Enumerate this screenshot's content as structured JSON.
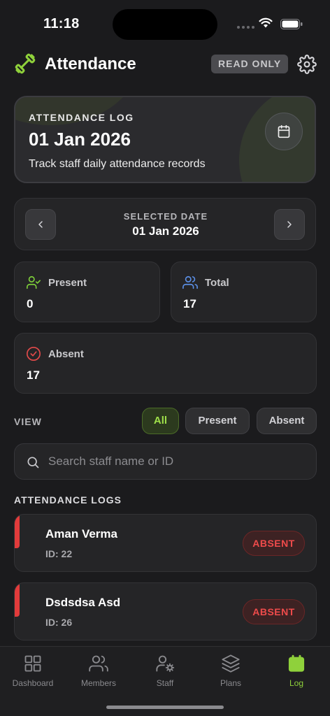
{
  "status_bar": {
    "time": "11:18"
  },
  "header": {
    "title": "Attendance",
    "badge": "READ ONLY",
    "logo_icon": "dumbbell-icon",
    "settings_icon": "gear-icon",
    "accent_color": "#8fd13b"
  },
  "hero": {
    "label": "ATTENDANCE LOG",
    "date": "01 Jan 2026",
    "subtitle": "Track staff daily attendance records",
    "icon": "calendar-icon"
  },
  "date_selector": {
    "label": "SELECTED DATE",
    "date": "01 Jan 2026",
    "prev_icon": "chevron-left-icon",
    "next_icon": "chevron-right-icon"
  },
  "stats": {
    "present": {
      "label": "Present",
      "value": "0",
      "icon": "user-check-icon",
      "color": "#7ecf3a"
    },
    "total": {
      "label": "Total",
      "value": "17",
      "icon": "users-icon",
      "color": "#5b8fe6"
    },
    "absent": {
      "label": "Absent",
      "value": "17",
      "icon": "circle-check-icon",
      "color": "#e24a4a"
    }
  },
  "view": {
    "label": "VIEW",
    "filters": [
      "All",
      "Present",
      "Absent"
    ],
    "selected": "All"
  },
  "search": {
    "placeholder": "Search staff name or ID",
    "value": ""
  },
  "logs": {
    "label": "ATTENDANCE LOGS",
    "items": [
      {
        "name": "Aman Verma",
        "id": "ID: 22",
        "status": "ABSENT"
      },
      {
        "name": "Dsdsdsa Asd",
        "id": "ID: 26",
        "status": "ABSENT"
      }
    ]
  },
  "tabs": [
    {
      "label": "Dashboard",
      "icon": "grid-icon",
      "active": false
    },
    {
      "label": "Members",
      "icon": "users-icon",
      "active": false
    },
    {
      "label": "Staff",
      "icon": "user-gear-icon",
      "active": false
    },
    {
      "label": "Plans",
      "icon": "layers-icon",
      "active": false
    },
    {
      "label": "Log",
      "icon": "calendar-filled-icon",
      "active": true
    }
  ]
}
